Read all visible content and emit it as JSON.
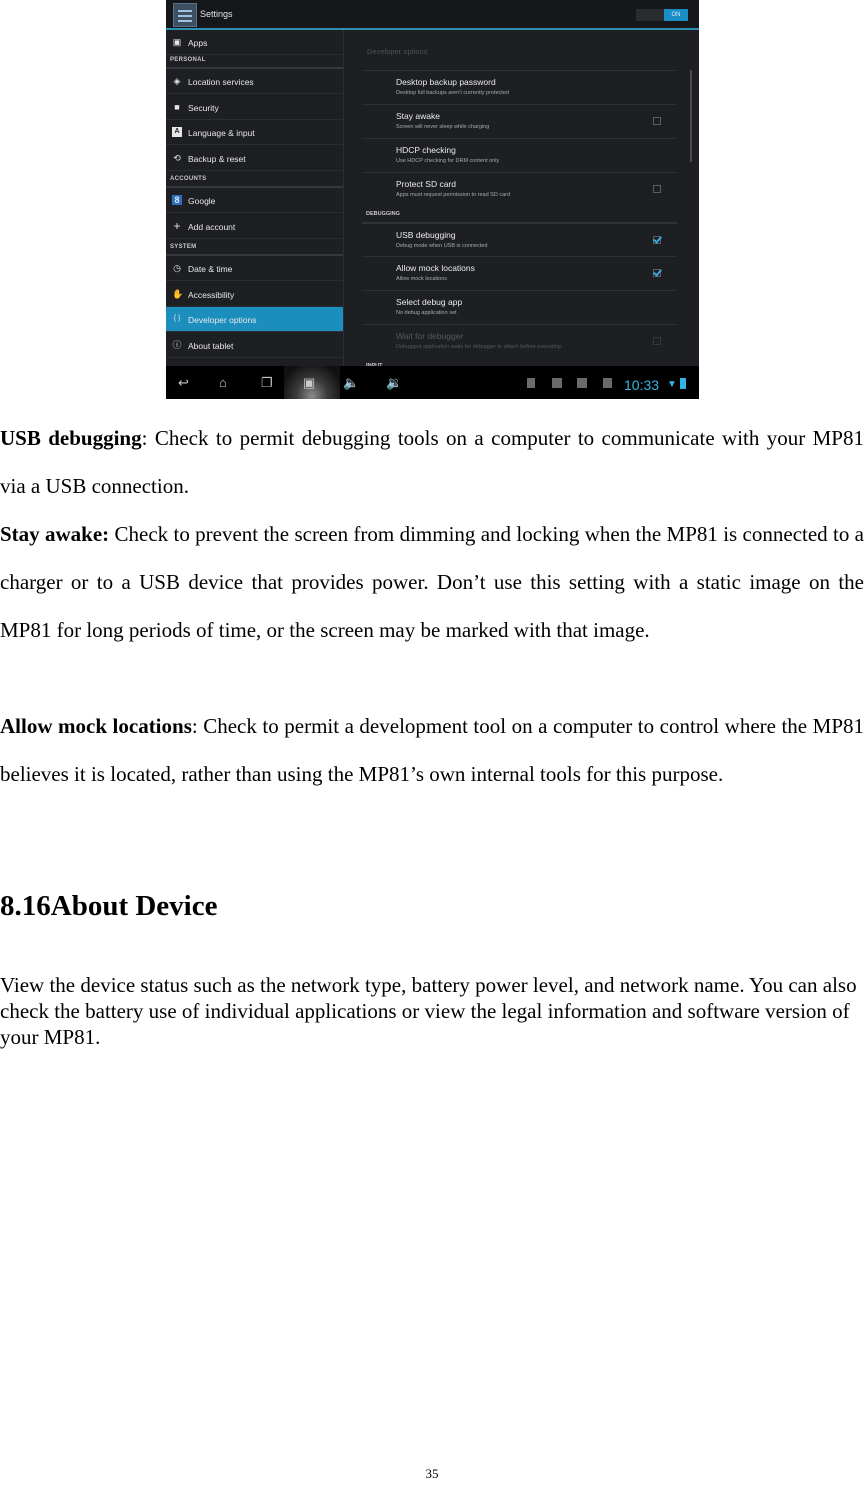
{
  "screenshot": {
    "action_bar": {
      "title": "Settings",
      "switch_label": "ON",
      "accent_color": "#33b5e5"
    },
    "sidebar": {
      "items": [
        {
          "icon": "apps-icon",
          "glyph": "▣",
          "label": "Apps"
        },
        {
          "header": "PERSONAL"
        },
        {
          "icon": "location-icon",
          "glyph": "◈",
          "label": "Location services"
        },
        {
          "icon": "lock-icon",
          "glyph": "🔒",
          "label": "Security"
        },
        {
          "icon": "language-icon",
          "glyph": "A",
          "label": "Language & input"
        },
        {
          "icon": "backup-icon",
          "glyph": "⟲",
          "label": "Backup & reset"
        },
        {
          "header": "ACCOUNTS"
        },
        {
          "icon": "google-icon",
          "glyph": "8",
          "label": "Google"
        },
        {
          "icon": "plus-icon",
          "glyph": "+",
          "label": "Add account"
        },
        {
          "header": "SYSTEM"
        },
        {
          "icon": "clock-icon",
          "glyph": "◷",
          "label": "Date & time"
        },
        {
          "icon": "hand-icon",
          "glyph": "✋",
          "label": "Accessibility"
        },
        {
          "icon": "braces-icon",
          "glyph": "{ }",
          "label": "Developer options",
          "active": true
        },
        {
          "icon": "info-icon",
          "glyph": "ⓘ",
          "label": "About tablet"
        }
      ]
    },
    "content": {
      "heading": "Developer options",
      "items": [
        {
          "title": "Desktop backup password",
          "summary": "Desktop full backups aren't currently protected",
          "checkbox": null
        },
        {
          "title": "Stay awake",
          "summary": "Screen will never sleep while charging",
          "checkbox": false
        },
        {
          "title": "HDCP checking",
          "summary": "Use HDCP checking for DRM content only",
          "checkbox": null
        },
        {
          "title": "Protect SD card",
          "summary": "Apps must request permission to read SD card",
          "checkbox": false
        },
        {
          "section": "DEBUGGING"
        },
        {
          "title": "USB debugging",
          "summary": "Debug mode when USB is connected",
          "checkbox": true
        },
        {
          "title": "Allow mock locations",
          "summary": "Allow mock locations",
          "checkbox": true
        },
        {
          "title": "Select debug app",
          "summary": "No debug application set",
          "checkbox": null
        },
        {
          "title": "Wait for debugger",
          "summary": "Debugged application waits for debugger to attach before executing",
          "checkbox": false,
          "disabled": true
        },
        {
          "section": "INPUT"
        }
      ]
    },
    "system_bar": {
      "nav_buttons": [
        "back-icon",
        "home-icon",
        "recent-apps-icon",
        "screenshot-icon",
        "volume-down-icon",
        "volume-up-icon"
      ],
      "notification_icons": [
        "sd-card-icon",
        "image-icon",
        "gmail-icon",
        "download-icon"
      ],
      "time": "10:33"
    }
  },
  "document": {
    "usb_debugging": {
      "lead": "USB debugging",
      "text": ": Check to permit debugging tools on a computer to communicate with your MP81 via a USB connection."
    },
    "stay_awake": {
      "lead": "Stay awake:",
      "text": " Check to prevent the screen from dimming and locking when the MP81 is connected to a charger or to a USB device that provides power. Don’t use this setting with a static image on the MP81 for long periods of time, or the screen may be marked with that image."
    },
    "allow_mock": {
      "lead": "Allow mock locations",
      "text": ": Check to permit a development tool on a computer to control where the MP81 believes it is located, rather than using the MP81’s own internal tools for this purpose."
    },
    "section_heading": "8.16About Device",
    "about_device_text": "View the device status such as the network type, battery power level, and network name. You can also check the battery use of individual applications or view the legal information and software version of your MP81.",
    "page_number": "35"
  }
}
